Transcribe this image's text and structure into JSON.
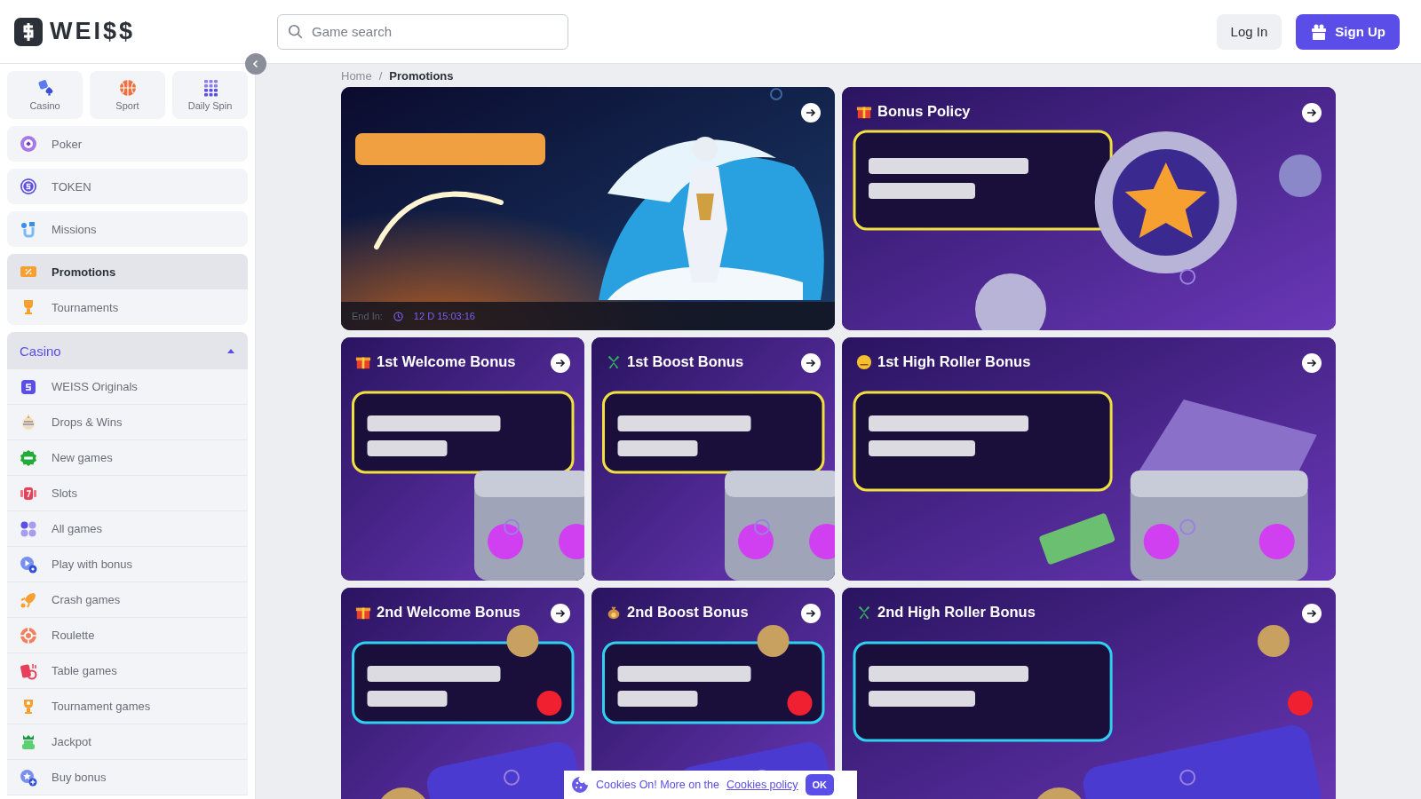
{
  "header": {
    "logo": "WEI$$",
    "search": {
      "placeholder": "Game search"
    },
    "buttons": [
      {
        "label": "Log In",
        "kind": "secondary"
      },
      {
        "label": "Sign Up",
        "kind": "primary"
      }
    ]
  },
  "sidebar": {
    "tiles": [
      {
        "label": "Casino"
      },
      {
        "label": "Sport"
      },
      {
        "label": "Daily Spin"
      }
    ],
    "items": [
      {
        "label": "Poker",
        "selected": false
      },
      {
        "label": "TOKEN",
        "selected": false
      },
      {
        "label": "Missions",
        "selected": false
      }
    ],
    "group": [
      {
        "label": "Promotions",
        "selected": true
      },
      {
        "label": "Tournaments",
        "selected": false
      }
    ],
    "section": {
      "title": "Casino",
      "expanded": true,
      "children": [
        {
          "label": "WEISS Originals"
        },
        {
          "label": "Drops & Wins"
        },
        {
          "label": "New games"
        },
        {
          "label": "Slots"
        },
        {
          "label": "All games"
        },
        {
          "label": "Play with bonus"
        },
        {
          "label": "Crash games"
        },
        {
          "label": "Roulette"
        },
        {
          "label": "Table games"
        },
        {
          "label": "Tournament games"
        },
        {
          "label": "Jackpot"
        },
        {
          "label": "Buy bonus"
        }
      ]
    }
  },
  "breadcrumb": {
    "separator": "/",
    "items": [
      {
        "label": "Home",
        "selected": false
      },
      {
        "label": "Promotions",
        "selected": true
      }
    ]
  },
  "promotions": [
    {
      "kind": "wide",
      "timer": {
        "label": "End In:",
        "value": "12 D 15:03:16"
      }
    },
    {
      "kind": "wide",
      "title": "Bonus Policy"
    },
    {
      "kind": "small",
      "title": "1st Welcome Bonus"
    },
    {
      "kind": "small",
      "title": "1st Boost Bonus"
    },
    {
      "kind": "wide",
      "title": "1st High Roller Bonus"
    },
    {
      "kind": "small",
      "title": "2nd Welcome Bonus"
    },
    {
      "kind": "small",
      "title": "2nd Boost Bonus"
    },
    {
      "kind": "wide",
      "title": "2nd High Roller Bonus"
    }
  ],
  "cookie_bar": {
    "text": "Cookies On! More on the",
    "link": "Cookies policy",
    "button": "OK"
  }
}
